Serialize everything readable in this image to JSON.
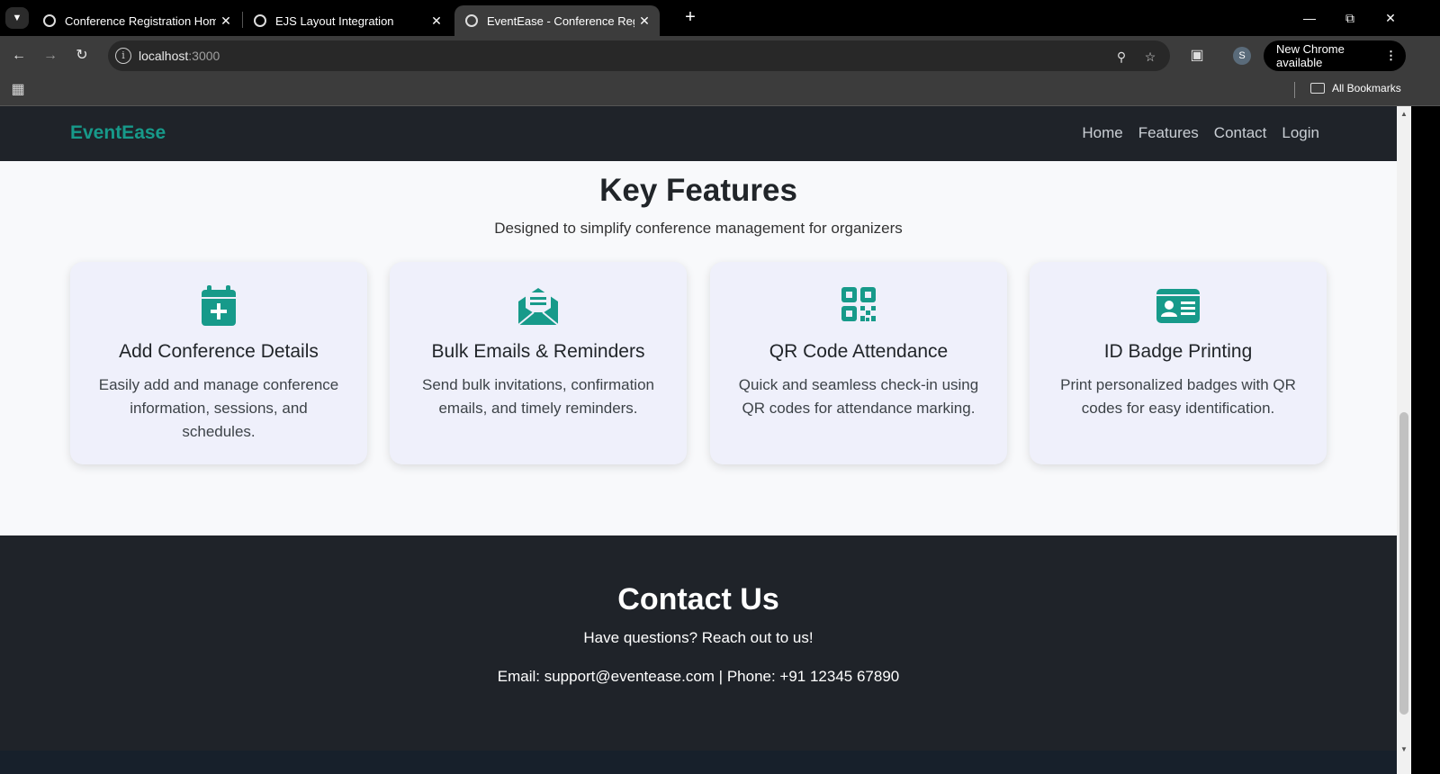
{
  "browser": {
    "tabs": [
      {
        "title": "Conference Registration Homep",
        "active": false
      },
      {
        "title": "EJS Layout Integration",
        "active": false
      },
      {
        "title": "EventEase - Conference Registra",
        "active": true
      }
    ],
    "url_host": "localhost",
    "url_port": ":3000",
    "profile_initial": "S",
    "update_label": "New Chrome available",
    "bookmarks_label": "All Bookmarks"
  },
  "nav": {
    "brand": "EventEase",
    "links": [
      "Home",
      "Features",
      "Contact",
      "Login"
    ]
  },
  "features": {
    "title": "Key Features",
    "subtitle": "Designed to simplify conference management for organizers",
    "cards": [
      {
        "icon": "calendar-plus-icon",
        "title": "Add Conference Details",
        "desc": "Easily add and manage conference information, sessions, and schedules."
      },
      {
        "icon": "envelope-open-text-icon",
        "title": "Bulk Emails & Reminders",
        "desc": "Send bulk invitations, confirmation emails, and timely reminders."
      },
      {
        "icon": "qrcode-icon",
        "title": "QR Code Attendance",
        "desc": "Quick and seamless check-in using QR codes for attendance marking."
      },
      {
        "icon": "id-card-icon",
        "title": "ID Badge Printing",
        "desc": "Print personalized badges with QR codes for easy identification."
      }
    ]
  },
  "contact": {
    "title": "Contact Us",
    "subtitle": "Have questions? Reach out to us!",
    "info": "Email: support@eventease.com | Phone: +91 12345 67890"
  },
  "colors": {
    "accent": "#179a8a",
    "navbar_bg": "#1f2329",
    "card_bg": "#eff0fb"
  }
}
